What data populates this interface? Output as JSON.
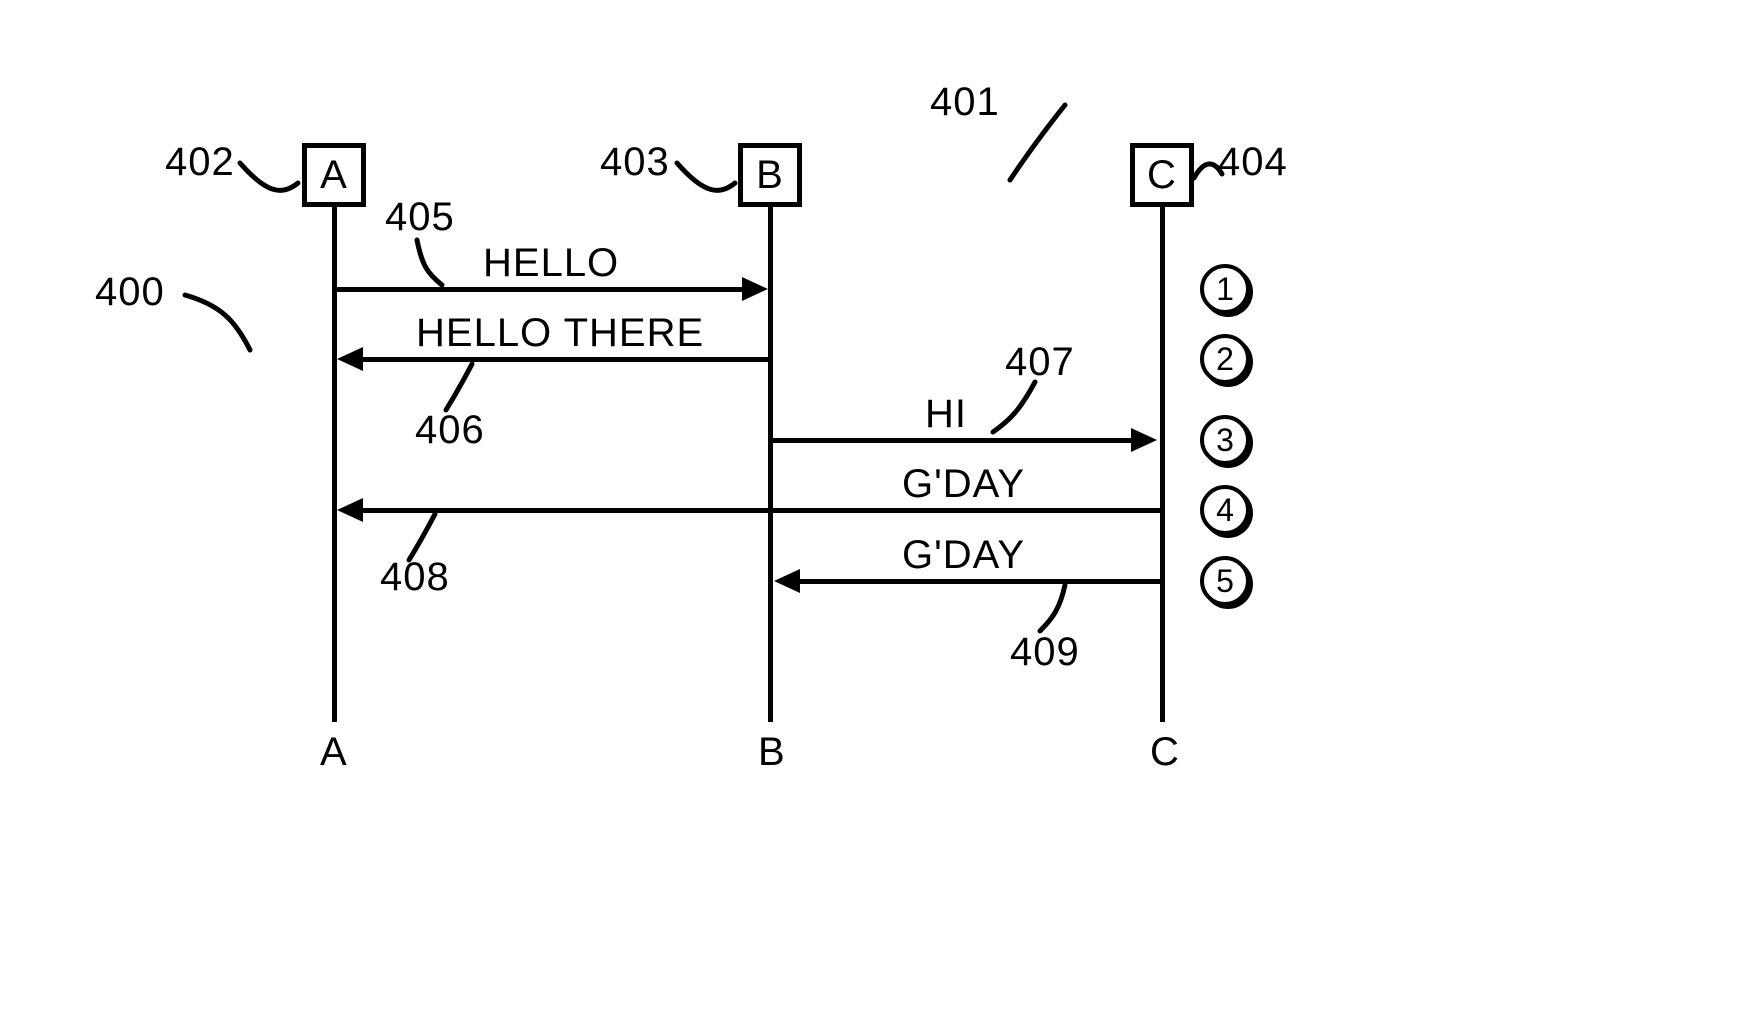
{
  "actors": {
    "a": {
      "label": "A",
      "ref": "402",
      "bottom_label": "A"
    },
    "b": {
      "label": "B",
      "ref": "403",
      "bottom_label": "B"
    },
    "c": {
      "label": "C",
      "ref": "404",
      "bottom_label": "C"
    }
  },
  "frame_ref_left": "400",
  "frame_ref_right": "401",
  "messages": {
    "m1": {
      "text": "HELLO",
      "ref": "405"
    },
    "m2": {
      "text": "HELLO THERE",
      "ref": "406"
    },
    "m3": {
      "text": "HI",
      "ref": "407"
    },
    "m4": {
      "text": "G'DAY",
      "ref": "408"
    },
    "m5": {
      "text": "G'DAY",
      "ref": "409"
    }
  },
  "steps": [
    "1",
    "2",
    "3",
    "4",
    "5"
  ]
}
